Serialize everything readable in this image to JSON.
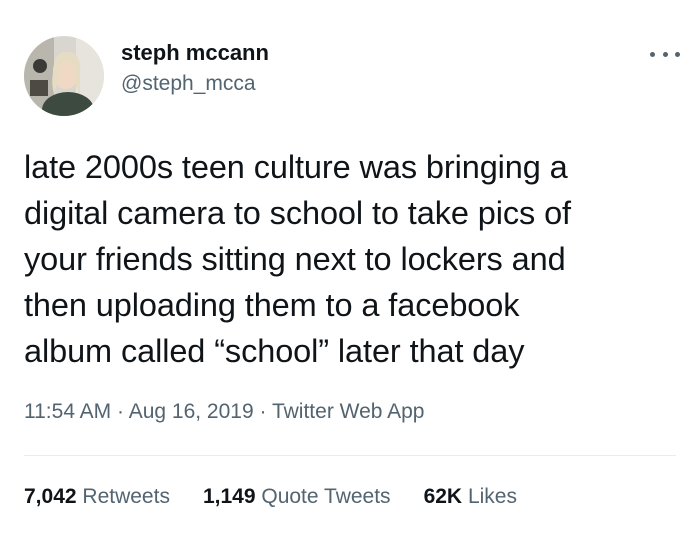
{
  "author": {
    "display_name": "steph mccann",
    "handle": "@steph_mcca"
  },
  "menu_icon": "more-horizontal-icon",
  "tweet_text": "late 2000s teen culture was bringing a\ndigital camera to school to take pics of\nyour friends sitting next to lockers and\nthen uploading them to a facebook\nalbum called “school” later that day",
  "meta": {
    "time": "11:54 AM",
    "separator": "·",
    "date": "Aug 16, 2019",
    "source": "Twitter Web App"
  },
  "stats": {
    "retweets": {
      "count": "7,042",
      "label": "Retweets"
    },
    "quote_tweets": {
      "count": "1,149",
      "label": "Quote Tweets"
    },
    "likes": {
      "count": "62K",
      "label": "Likes"
    }
  },
  "colors": {
    "text_primary": "#0f1419",
    "text_secondary": "#536471",
    "divider": "#e6ecf0",
    "background": "#ffffff"
  }
}
